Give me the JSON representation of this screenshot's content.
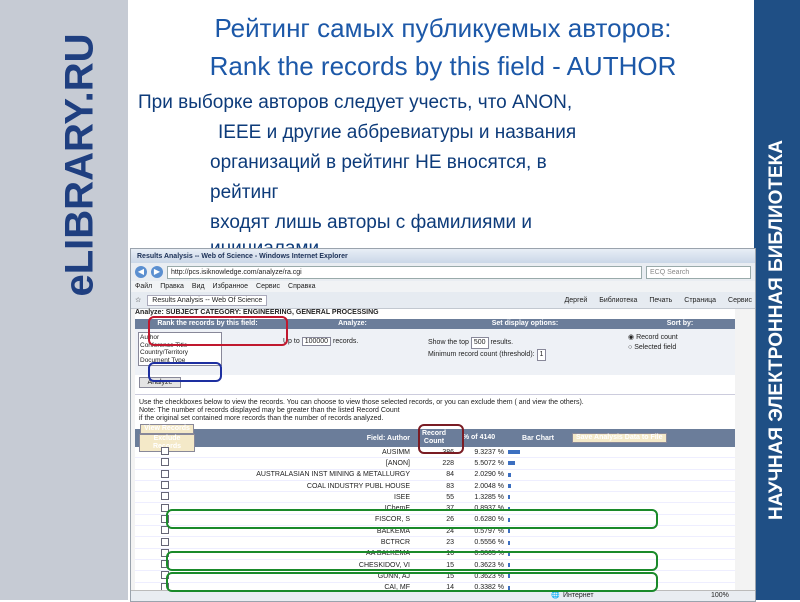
{
  "slide": {
    "title_line1": "Рейтинг самых публикуемых авторов:",
    "title_line2": "Rank the records by this field - AUTHOR",
    "note_lines": [
      "При выборке авторов следует учесть, что ANON,",
      "  IEEE и другие аббревиатуры и названия",
      "организаций в рейтинг НЕ вносятся, в",
      "рейтинг",
      "входят лишь авторы с фамилиями и",
      "инициалами."
    ],
    "left_logo": "eLIBRARY.RU",
    "right_logo": "НАУЧНАЯ ЭЛЕКТРОННАЯ БИБЛИОТЕКА"
  },
  "colors": {
    "highlight_red": "#c0182e",
    "highlight_blue": "#1d2fa0",
    "highlight_green": "#1a8a2a",
    "brand_blue": "#1f4f85"
  },
  "browser": {
    "window_title": "Results Analysis -- Web of Science - Windows Internet Explorer",
    "url": "http://pcs.isiknowledge.com/analyze/ra.cgi",
    "search_placeholder": "ECQ Search",
    "menu": [
      "Файл",
      "Правка",
      "Вид",
      "Избранное",
      "Сервис",
      "Справка"
    ],
    "tab": "Results Analysis -- Web Of Science",
    "toolbar": [
      "Дергей",
      "Библиотека",
      "Печать",
      "Страница",
      "Сервис"
    ],
    "status": "Интернет",
    "zoom": "100%"
  },
  "panel": {
    "section_header": "Analyze: SUBJECT CATEGORY: ENGINEERING, GENERAL PROCESSING",
    "rank_header": "Rank the records by this field:",
    "analyze_header": "Analyze:",
    "display_header": "Set display options:",
    "sort_header": "Sort by:",
    "fields": [
      "Author",
      "Conference Title",
      "Country/Territory",
      "Document Type"
    ],
    "up_to_label": "Up to",
    "up_to_value": "100000",
    "records_label": "records.",
    "show_top_label": "Show the top",
    "show_top_value": "500",
    "results_label": "results.",
    "min_count_label": "Minimum record count (threshold):",
    "min_count_value": "1",
    "sort_options": [
      "Record count",
      "Selected field"
    ],
    "analyze_button": "Analyze"
  },
  "instructions": [
    "Use the checkboxes below to view the records. You can choose to view those selected records, or you can exclude them ( and view the others).",
    "Note: The number of records displayed may be greater than the listed Record Count",
    "if the original set contained more records than the number of records analyzed."
  ],
  "results": {
    "view_button": "View Records",
    "exclude_button": "Exclude Records",
    "col_field": "Field: Author",
    "col_count": "Record Count",
    "col_percent": "% of 4140",
    "col_chart": "Bar Chart",
    "save_button": "Save Analysis Data to File",
    "rows": [
      {
        "author": "AUSIMM",
        "count": "386",
        "percent": "9.3237 %",
        "bar": 9.3237
      },
      {
        "author": "[ANON]",
        "count": "228",
        "percent": "5.5072 %",
        "bar": 5.5072
      },
      {
        "author": "AUSTRALASIAN INST MINING & METALLURGY",
        "count": "84",
        "percent": "2.0290 %",
        "bar": 2.029
      },
      {
        "author": "COAL INDUSTRY PUBL HOUSE",
        "count": "83",
        "percent": "2.0048 %",
        "bar": 2.0048
      },
      {
        "author": "ISEE",
        "count": "55",
        "percent": "1.3285 %",
        "bar": 1.3285
      },
      {
        "author": "IChemE",
        "count": "37",
        "percent": "0.8937 %",
        "bar": 0.8937
      },
      {
        "author": "FISCOR, S",
        "count": "26",
        "percent": "0.6280 %",
        "bar": 0.628
      },
      {
        "author": "BALKEMA",
        "count": "24",
        "percent": "0.5797 %",
        "bar": 0.5797
      },
      {
        "author": "BCTRCR",
        "count": "23",
        "percent": "0.5556 %",
        "bar": 0.5556
      },
      {
        "author": "AA BALKEMA",
        "count": "16",
        "percent": "0.3865 %",
        "bar": 0.3865
      },
      {
        "author": "CHESKIDOV, VI",
        "count": "15",
        "percent": "0.3623 %",
        "bar": 0.3623
      },
      {
        "author": "GUNN, AJ",
        "count": "15",
        "percent": "0.3623 %",
        "bar": 0.3623
      },
      {
        "author": "CAI, MF",
        "count": "14",
        "percent": "0.3382 %",
        "bar": 0.3382
      }
    ]
  }
}
